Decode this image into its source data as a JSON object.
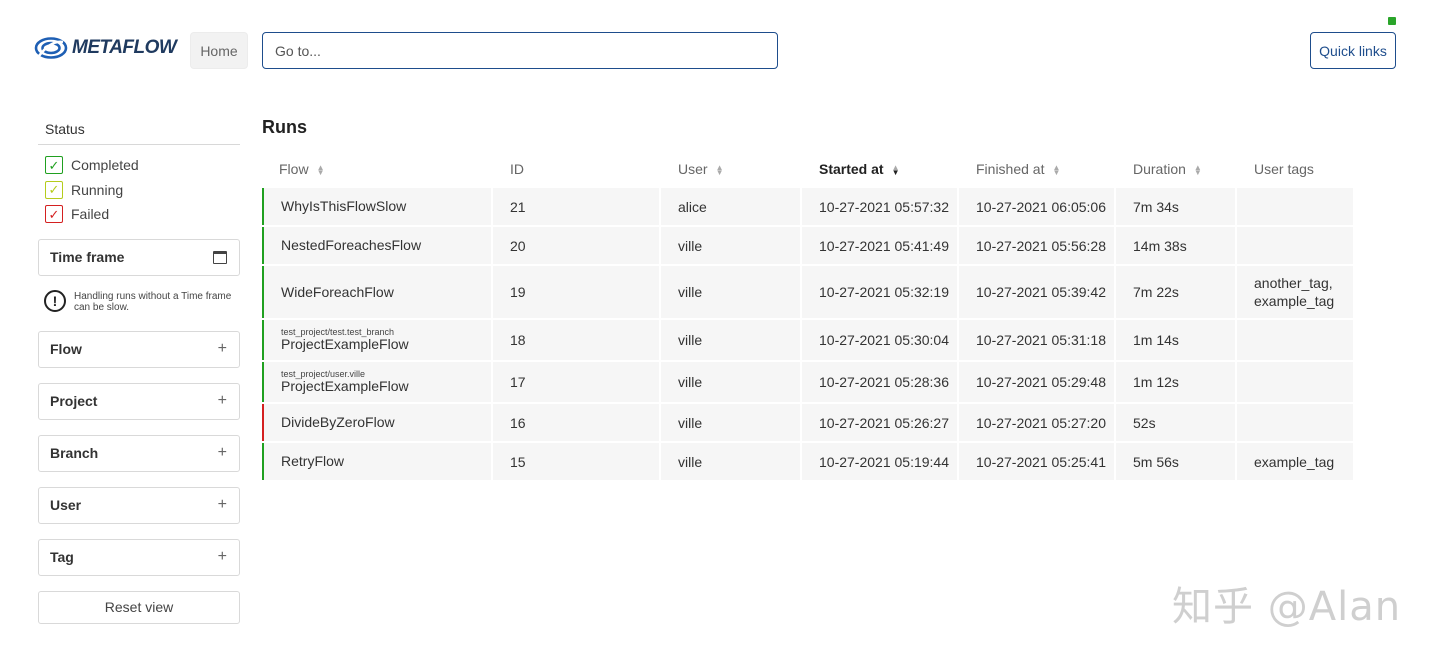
{
  "header": {
    "logo_text": "METAFLOW",
    "home_label": "Home",
    "search_placeholder": "Go to...",
    "quick_links_label": "Quick links",
    "connection_color": "#2aa52a"
  },
  "sidebar": {
    "status_title": "Status",
    "statuses": [
      {
        "label": "Completed",
        "color": "#20a020",
        "checked": true
      },
      {
        "label": "Running",
        "color": "#b5cc1c",
        "checked": true
      },
      {
        "label": "Failed",
        "color": "#d42020",
        "checked": true
      }
    ],
    "time_frame_label": "Time frame",
    "time_frame_note": "Handling runs without a Time frame can be slow.",
    "filters": [
      {
        "label": "Flow"
      },
      {
        "label": "Project"
      },
      {
        "label": "Branch"
      },
      {
        "label": "User"
      },
      {
        "label": "Tag"
      }
    ],
    "reset_label": "Reset view"
  },
  "main": {
    "title": "Runs",
    "columns": [
      "Flow",
      "ID",
      "User",
      "Started at",
      "Finished at",
      "Duration",
      "User tags"
    ],
    "sorted_column": "Started at",
    "rows": [
      {
        "project": "",
        "flow": "WhyIsThisFlowSlow",
        "id": "21",
        "user": "alice",
        "started": "10-27-2021 05:57:32",
        "finished": "10-27-2021 06:05:06",
        "duration": "7m 34s",
        "tags": "",
        "status": "completed"
      },
      {
        "project": "",
        "flow": "NestedForeachesFlow",
        "id": "20",
        "user": "ville",
        "started": "10-27-2021 05:41:49",
        "finished": "10-27-2021 05:56:28",
        "duration": "14m 38s",
        "tags": "",
        "status": "completed"
      },
      {
        "project": "",
        "flow": "WideForeachFlow",
        "id": "19",
        "user": "ville",
        "started": "10-27-2021 05:32:19",
        "finished": "10-27-2021 05:39:42",
        "duration": "7m 22s",
        "tags": "another_tag, example_tag",
        "status": "completed"
      },
      {
        "project": "test_project/test.test_branch",
        "flow": "ProjectExampleFlow",
        "id": "18",
        "user": "ville",
        "started": "10-27-2021 05:30:04",
        "finished": "10-27-2021 05:31:18",
        "duration": "1m 14s",
        "tags": "",
        "status": "completed"
      },
      {
        "project": "test_project/user.ville",
        "flow": "ProjectExampleFlow",
        "id": "17",
        "user": "ville",
        "started": "10-27-2021 05:28:36",
        "finished": "10-27-2021 05:29:48",
        "duration": "1m 12s",
        "tags": "",
        "status": "completed"
      },
      {
        "project": "",
        "flow": "DivideByZeroFlow",
        "id": "16",
        "user": "ville",
        "started": "10-27-2021 05:26:27",
        "finished": "10-27-2021 05:27:20",
        "duration": "52s",
        "tags": "",
        "status": "failed"
      },
      {
        "project": "",
        "flow": "RetryFlow",
        "id": "15",
        "user": "ville",
        "started": "10-27-2021 05:19:44",
        "finished": "10-27-2021 05:25:41",
        "duration": "5m 56s",
        "tags": "example_tag",
        "status": "completed"
      }
    ]
  },
  "watermark": "知乎 @Alan"
}
